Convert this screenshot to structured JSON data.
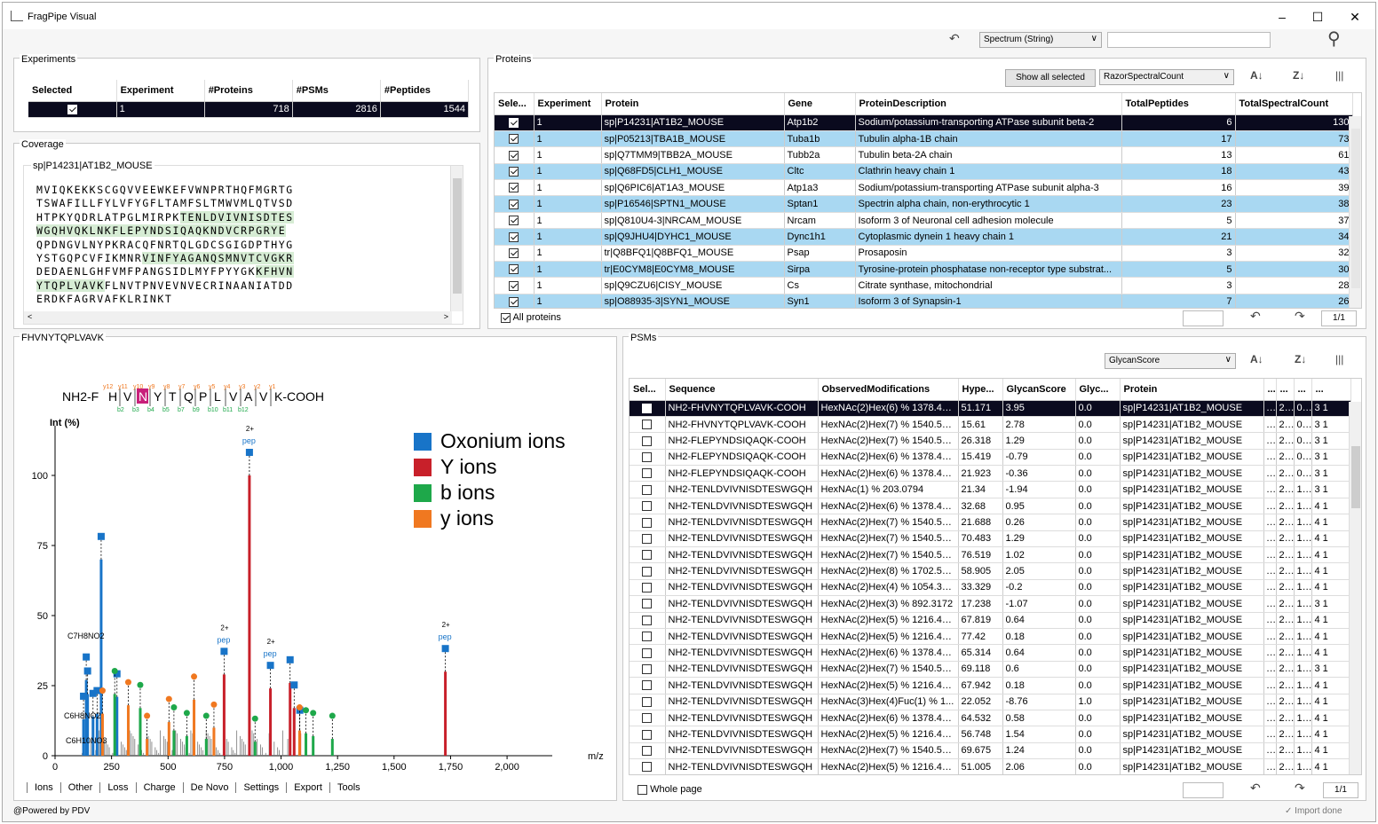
{
  "app": {
    "title": "FragPipe Visual",
    "footer": "@Powered by PDV",
    "status": "Import done"
  },
  "toolbar": {
    "search_type": "Spectrum (String)",
    "search_value": ""
  },
  "experiments": {
    "label": "Experiments",
    "columns": [
      "Selected",
      "Experiment",
      "#Proteins",
      "#PSMs",
      "#Peptides"
    ],
    "rows": [
      {
        "selected": true,
        "experiment": "1",
        "proteins": "718",
        "psms": "2816",
        "peptides": "1544"
      }
    ]
  },
  "coverage": {
    "label": "Coverage",
    "protein": "sp|P14231|AT1B2_MOUSE",
    "lines": [
      [
        {
          "t": "MVIQKEKKSCGQVVEEWKEFVWNPRTHQFMGRTG",
          "h": false
        }
      ],
      [
        {
          "t": "TSWAFILLFYLVFYGFLTAMFSLTMWVMLQTVSD",
          "h": false
        }
      ],
      [
        {
          "t": "HTPKYQDRLATPGLMIRPK",
          "h": false
        },
        {
          "t": "TENLDVIVNISDTES",
          "h": true
        }
      ],
      [
        {
          "t": "WGQHVQKLNK",
          "h": true
        },
        {
          "t": "FLEPYNDSIQAQKNDVCRPGRYE",
          "h": true
        }
      ],
      [
        {
          "t": "QPDNGVLNYPKRACQFNRTQLGDCSGIGDPTHYG",
          "h": false
        }
      ],
      [
        {
          "t": "YSTGQPCVFIKMNR",
          "h": false
        },
        {
          "t": "VINFYAGANQSMNVTCVGKR",
          "h": true
        }
      ],
      [
        {
          "t": "DEDAENLGHFVMFPANGSIDLMYFPYYGK",
          "h": false
        },
        {
          "t": "KFHVN",
          "h": true
        }
      ],
      [
        {
          "t": "YTQPLVAVK",
          "h": true
        },
        {
          "t": "FLNVTPNVEVNVECRINAANIATDD",
          "h": false
        }
      ],
      [
        {
          "t": "ERDKFAGRVAFKLRINKT",
          "h": false
        }
      ]
    ]
  },
  "proteins": {
    "label": "Proteins",
    "show_all": "Show all selected",
    "sort_field": "RazorSpectralCount",
    "all_label": "All proteins",
    "page": "1/1",
    "columns": [
      "Sele...",
      "Experiment",
      "Protein",
      "Gene",
      "ProteinDescription",
      "TotalPeptides",
      "TotalSpectralCount"
    ],
    "rows": [
      {
        "exp": "1",
        "protein": "sp|P14231|AT1B2_MOUSE",
        "gene": "Atp1b2",
        "desc": "Sodium/potassium-transporting ATPase subunit beta-2",
        "pep": "6",
        "spc": "130"
      },
      {
        "exp": "1",
        "protein": "sp|P05213|TBA1B_MOUSE",
        "gene": "Tuba1b",
        "desc": "Tubulin alpha-1B chain",
        "pep": "17",
        "spc": "73"
      },
      {
        "exp": "1",
        "protein": "sp|Q7TMM9|TBB2A_MOUSE",
        "gene": "Tubb2a",
        "desc": "Tubulin beta-2A chain",
        "pep": "13",
        "spc": "61"
      },
      {
        "exp": "1",
        "protein": "sp|Q68FD5|CLH1_MOUSE",
        "gene": "Cltc",
        "desc": "Clathrin heavy chain 1",
        "pep": "18",
        "spc": "43"
      },
      {
        "exp": "1",
        "protein": "sp|Q6PIC6|AT1A3_MOUSE",
        "gene": "Atp1a3",
        "desc": "Sodium/potassium-transporting ATPase subunit alpha-3",
        "pep": "16",
        "spc": "39"
      },
      {
        "exp": "1",
        "protein": "sp|P16546|SPTN1_MOUSE",
        "gene": "Sptan1",
        "desc": "Spectrin alpha chain, non-erythrocytic 1",
        "pep": "23",
        "spc": "38"
      },
      {
        "exp": "1",
        "protein": "sp|Q810U4-3|NRCAM_MOUSE",
        "gene": "Nrcam",
        "desc": "Isoform 3 of Neuronal cell adhesion molecule",
        "pep": "5",
        "spc": "37"
      },
      {
        "exp": "1",
        "protein": "sp|Q9JHU4|DYHC1_MOUSE",
        "gene": "Dync1h1",
        "desc": "Cytoplasmic dynein 1 heavy chain 1",
        "pep": "21",
        "spc": "34"
      },
      {
        "exp": "1",
        "protein": "tr|Q8BFQ1|Q8BFQ1_MOUSE",
        "gene": "Psap",
        "desc": "Prosaposin",
        "pep": "3",
        "spc": "32"
      },
      {
        "exp": "1",
        "protein": "tr|E0CYM8|E0CYM8_MOUSE",
        "gene": "Sirpa",
        "desc": "Tyrosine-protein phosphatase non-receptor type substrat...",
        "pep": "5",
        "spc": "30"
      },
      {
        "exp": "1",
        "protein": "sp|Q9CZU6|CISY_MOUSE",
        "gene": "Cs",
        "desc": "Citrate synthase, mitochondrial",
        "pep": "3",
        "spc": "28"
      },
      {
        "exp": "1",
        "protein": "sp|O88935-3|SYN1_MOUSE",
        "gene": "Syn1",
        "desc": "Isoform 3 of Synapsin-1",
        "pep": "7",
        "spc": "26"
      }
    ]
  },
  "spectrum": {
    "label": "FHVNYTQPLVAVK",
    "prefix": "NH2-F",
    "suffix": "K-COOH",
    "residues": [
      "H",
      "V",
      "N",
      "Y",
      "T",
      "Q",
      "P",
      "L",
      "V",
      "A",
      "V"
    ],
    "y_top": [
      "y12",
      "y11",
      "y10",
      "y9",
      "y8",
      "y7",
      "y6",
      "y5",
      "y4",
      "y3",
      "y2",
      "y1"
    ],
    "b_bottom": [
      "b2",
      "b3",
      "b4",
      "b5",
      "b7",
      "b9",
      "b10",
      "b11",
      "b12"
    ],
    "xlabel": "m/z",
    "ylabel": "Int (%)",
    "legend": [
      {
        "name": "Oxonium ions",
        "color": "#1874c8"
      },
      {
        "name": "Y ions",
        "color": "#c8202a"
      },
      {
        "name": "b ions",
        "color": "#1ea84a"
      },
      {
        "name": "y ions",
        "color": "#f07820"
      }
    ],
    "annotations": [
      "C7H8NO2",
      "C6H8NO2",
      "C6H10NO3",
      "2+",
      "pep"
    ],
    "tabs": [
      "Ions",
      "Other",
      "Loss",
      "Charge",
      "De Novo",
      "Settings",
      "Export",
      "Tools"
    ]
  },
  "chart_data": {
    "type": "bar",
    "title": "",
    "xlabel": "m/z",
    "ylabel": "Int (%)",
    "xlim": [
      0,
      2200
    ],
    "ylim": [
      0,
      120
    ],
    "xticks": [
      "0",
      "250",
      "500",
      "750",
      "1,000",
      "1,250",
      "1,500",
      "1,750",
      "2,000"
    ],
    "yticks": [
      "0",
      "25",
      "50",
      "75",
      "100"
    ],
    "series": [
      {
        "name": "Oxonium ions",
        "color": "#1874c8",
        "x": [
          126,
          138,
          144,
          168,
          186,
          204,
          274
        ],
        "y": [
          13,
          27,
          22,
          14,
          15,
          70,
          21
        ]
      },
      {
        "name": "Y ions",
        "color": "#c8202a",
        "x": [
          748,
          860,
          953,
          1040,
          1058,
          1083,
          1727
        ],
        "y": [
          29,
          100,
          24,
          26,
          17,
          8,
          30
        ]
      },
      {
        "name": "b ions",
        "color": "#1ea84a",
        "x": [
          264,
          377,
          526,
          583,
          669,
          885,
          1110,
          1142,
          1227
        ],
        "y": [
          22,
          17,
          9,
          7,
          6,
          5,
          8,
          7,
          6
        ]
      },
      {
        "name": "y ions",
        "color": "#f07820",
        "x": [
          210,
          324,
          407,
          504,
          615,
          703,
          1082
        ],
        "y": [
          15,
          18,
          6,
          12,
          20,
          10,
          9
        ]
      }
    ]
  },
  "psms": {
    "label": "PSMs",
    "sort_field": "GlycanScore",
    "page": "1/1",
    "whole_page": "Whole page",
    "columns": [
      "Sel...",
      "Sequence",
      "ObservedModifications",
      "Hype...",
      "GlycanScore",
      "Glyc...",
      "Protein",
      "...",
      "...",
      "...",
      "..."
    ],
    "rows": [
      {
        "seq": "NH2-FHVNYTQPLVAVK-COOH",
        "mod": "HexNAc(2)Hex(6) % 1378.47...",
        "hyp": "51.171",
        "gs": "3.95",
        "gq": "0.0",
        "prot": "sp|P14231|AT1B2_MOUSE",
        "a": "...",
        "b": "2...",
        "c": "0...",
        "d": "3 1"
      },
      {
        "seq": "NH2-FHVNYTQPLVAVK-COOH",
        "mod": "HexNAc(2)Hex(7) % 1540.52...",
        "hyp": "15.61",
        "gs": "2.78",
        "gq": "0.0",
        "prot": "sp|P14231|AT1B2_MOUSE",
        "a": "...",
        "b": "2...",
        "c": "0...",
        "d": "3 1"
      },
      {
        "seq": "NH2-FLEPYNDSIQAQK-COOH",
        "mod": "HexNAc(2)Hex(7) % 1540.52...",
        "hyp": "26.318",
        "gs": "1.29",
        "gq": "0.0",
        "prot": "sp|P14231|AT1B2_MOUSE",
        "a": "...",
        "b": "2...",
        "c": "0...",
        "d": "3 1"
      },
      {
        "seq": "NH2-FLEPYNDSIQAQK-COOH",
        "mod": "HexNAc(2)Hex(6) % 1378.47...",
        "hyp": "15.419",
        "gs": "-0.79",
        "gq": "0.0",
        "prot": "sp|P14231|AT1B2_MOUSE",
        "a": "...",
        "b": "2...",
        "c": "0...",
        "d": "3 1"
      },
      {
        "seq": "NH2-FLEPYNDSIQAQK-COOH",
        "mod": "HexNAc(2)Hex(6) % 1378.47...",
        "hyp": "21.923",
        "gs": "-0.36",
        "gq": "0.0",
        "prot": "sp|P14231|AT1B2_MOUSE",
        "a": "...",
        "b": "2...",
        "c": "0...",
        "d": "3 1"
      },
      {
        "seq": "NH2-TENLDVIVNISDTESWGQH",
        "mod": "HexNAc(1) % 203.0794",
        "hyp": "21.34",
        "gs": "-1.94",
        "gq": "0.0",
        "prot": "sp|P14231|AT1B2_MOUSE",
        "a": "...",
        "b": "2...",
        "c": "1...",
        "d": "3 1"
      },
      {
        "seq": "NH2-TENLDVIVNISDTESWGQH",
        "mod": "HexNAc(2)Hex(6) % 1378.47...",
        "hyp": "32.68",
        "gs": "0.95",
        "gq": "0.0",
        "prot": "sp|P14231|AT1B2_MOUSE",
        "a": "...",
        "b": "2...",
        "c": "1...",
        "d": "4 1"
      },
      {
        "seq": "NH2-TENLDVIVNISDTESWGQH",
        "mod": "HexNAc(2)Hex(7) % 1540.52...",
        "hyp": "21.688",
        "gs": "0.26",
        "gq": "0.0",
        "prot": "sp|P14231|AT1B2_MOUSE",
        "a": "...",
        "b": "2...",
        "c": "1...",
        "d": "4 1"
      },
      {
        "seq": "NH2-TENLDVIVNISDTESWGQH",
        "mod": "HexNAc(2)Hex(7) % 1540.52...",
        "hyp": "70.483",
        "gs": "1.29",
        "gq": "0.0",
        "prot": "sp|P14231|AT1B2_MOUSE",
        "a": "...",
        "b": "2...",
        "c": "1...",
        "d": "4 1"
      },
      {
        "seq": "NH2-TENLDVIVNISDTESWGQH",
        "mod": "HexNAc(2)Hex(7) % 1540.52...",
        "hyp": "76.519",
        "gs": "1.02",
        "gq": "0.0",
        "prot": "sp|P14231|AT1B2_MOUSE",
        "a": "...",
        "b": "2...",
        "c": "1...",
        "d": "4 1"
      },
      {
        "seq": "NH2-TENLDVIVNISDTESWGQH",
        "mod": "HexNAc(2)Hex(8) % 1702.58...",
        "hyp": "58.905",
        "gs": "2.05",
        "gq": "0.0",
        "prot": "sp|P14231|AT1B2_MOUSE",
        "a": "...",
        "b": "2...",
        "c": "1...",
        "d": "4 1"
      },
      {
        "seq": "NH2-TENLDVIVNISDTESWGQH",
        "mod": "HexNAc(2)Hex(4) % 1054.37...",
        "hyp": "33.329",
        "gs": "-0.2",
        "gq": "0.0",
        "prot": "sp|P14231|AT1B2_MOUSE",
        "a": "...",
        "b": "2...",
        "c": "1...",
        "d": "4 1"
      },
      {
        "seq": "NH2-TENLDVIVNISDTESWGQH",
        "mod": "HexNAc(2)Hex(3) % 892.3172",
        "hyp": "17.238",
        "gs": "-1.07",
        "gq": "0.0",
        "prot": "sp|P14231|AT1B2_MOUSE",
        "a": "...",
        "b": "2...",
        "c": "1...",
        "d": "3 1"
      },
      {
        "seq": "NH2-TENLDVIVNISDTESWGQH",
        "mod": "HexNAc(2)Hex(5) % 1216.42...",
        "hyp": "67.819",
        "gs": "0.64",
        "gq": "0.0",
        "prot": "sp|P14231|AT1B2_MOUSE",
        "a": "...",
        "b": "2...",
        "c": "1...",
        "d": "4 1"
      },
      {
        "seq": "NH2-TENLDVIVNISDTESWGQH",
        "mod": "HexNAc(2)Hex(5) % 1216.42...",
        "hyp": "77.42",
        "gs": "0.18",
        "gq": "0.0",
        "prot": "sp|P14231|AT1B2_MOUSE",
        "a": "...",
        "b": "2...",
        "c": "1...",
        "d": "4 1"
      },
      {
        "seq": "NH2-TENLDVIVNISDTESWGQH",
        "mod": "HexNAc(2)Hex(6) % 1378.47...",
        "hyp": "65.314",
        "gs": "0.64",
        "gq": "0.0",
        "prot": "sp|P14231|AT1B2_MOUSE",
        "a": "...",
        "b": "2...",
        "c": "1...",
        "d": "4 1"
      },
      {
        "seq": "NH2-TENLDVIVNISDTESWGQH",
        "mod": "HexNAc(2)Hex(7) % 1540.52...",
        "hyp": "69.118",
        "gs": "0.6",
        "gq": "0.0",
        "prot": "sp|P14231|AT1B2_MOUSE",
        "a": "...",
        "b": "2...",
        "c": "1...",
        "d": "3 1"
      },
      {
        "seq": "NH2-TENLDVIVNISDTESWGQH",
        "mod": "HexNAc(2)Hex(5) % 1216.42...",
        "hyp": "67.942",
        "gs": "0.18",
        "gq": "0.0",
        "prot": "sp|P14231|AT1B2_MOUSE",
        "a": "...",
        "b": "2...",
        "c": "1...",
        "d": "4 1"
      },
      {
        "seq": "NH2-TENLDVIVNISDTESWGQH",
        "mod": "HexNAc(3)Hex(4)Fuc(1) % 1...",
        "hyp": "22.052",
        "gs": "-8.76",
        "gq": "1.0",
        "prot": "sp|P14231|AT1B2_MOUSE",
        "a": "...",
        "b": "2...",
        "c": "1...",
        "d": "4 1"
      },
      {
        "seq": "NH2-TENLDVIVNISDTESWGQH",
        "mod": "HexNAc(2)Hex(6) % 1378.47...",
        "hyp": "64.532",
        "gs": "0.58",
        "gq": "0.0",
        "prot": "sp|P14231|AT1B2_MOUSE",
        "a": "...",
        "b": "2...",
        "c": "1...",
        "d": "4 1"
      },
      {
        "seq": "NH2-TENLDVIVNISDTESWGQH",
        "mod": "HexNAc(2)Hex(5) % 1216.42...",
        "hyp": "56.748",
        "gs": "1.54",
        "gq": "0.0",
        "prot": "sp|P14231|AT1B2_MOUSE",
        "a": "...",
        "b": "2...",
        "c": "1...",
        "d": "4 1"
      },
      {
        "seq": "NH2-TENLDVIVNISDTESWGQH",
        "mod": "HexNAc(2)Hex(7) % 1540.52...",
        "hyp": "69.675",
        "gs": "1.24",
        "gq": "0.0",
        "prot": "sp|P14231|AT1B2_MOUSE",
        "a": "...",
        "b": "2...",
        "c": "1...",
        "d": "4 1"
      },
      {
        "seq": "NH2-TENLDVIVNISDTESWGQH",
        "mod": "HexNAc(2)Hex(5) % 1216.42...",
        "hyp": "51.005",
        "gs": "2.06",
        "gq": "0.0",
        "prot": "sp|P14231|AT1B2_MOUSE",
        "a": "...",
        "b": "2...",
        "c": "1...",
        "d": "4 1"
      }
    ]
  }
}
